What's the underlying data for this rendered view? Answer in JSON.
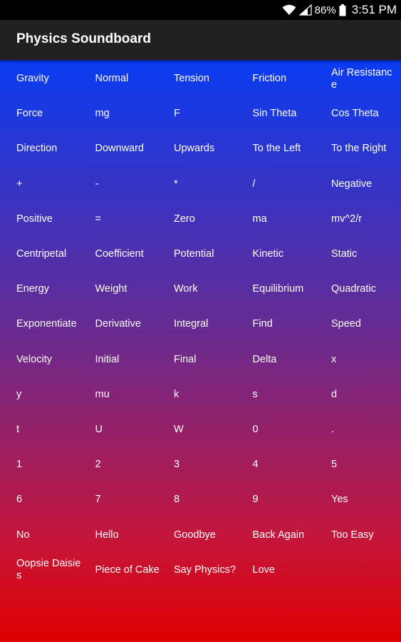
{
  "status_bar": {
    "battery_percent": "86%",
    "time": "3:51 PM"
  },
  "app_bar": {
    "title": "Physics Soundboard"
  },
  "colors": {
    "app_bar": "#212121",
    "gradient_top": "#0a3cf2",
    "gradient_bottom": "#e00000"
  },
  "buttons": [
    "Gravity",
    "Normal",
    "Tension",
    "Friction",
    "Air Resistance",
    "Force",
    "mg",
    "F",
    "Sin Theta",
    "Cos Theta",
    "Direction",
    "Downward",
    "Upwards",
    "To the Left",
    "To the Right",
    "+",
    "-",
    "*",
    "/",
    "Negative",
    "Positive",
    "=",
    "Zero",
    "ma",
    "mv^2/r",
    "Centripetal",
    "Coefficient",
    "Potential",
    "Kinetic",
    "Static",
    "Energy",
    "Weight",
    "Work",
    "Equilibrium",
    "Quadratic",
    "Exponentiate",
    "Derivative",
    "Integral",
    "Find",
    "Speed",
    "Velocity",
    "Initial",
    "Final",
    "Delta",
    "x",
    "y",
    "mu",
    "k",
    "s",
    "d",
    "t",
    "U",
    "W",
    "0",
    ".",
    "1",
    "2",
    "3",
    "4",
    "5",
    "6",
    "7",
    "8",
    "9",
    "Yes",
    "No",
    "Hello",
    "Goodbye",
    "Back Again",
    "Too Easy",
    "Oopsie Daisies",
    "Piece of Cake",
    "Say Physics?",
    "Love"
  ]
}
